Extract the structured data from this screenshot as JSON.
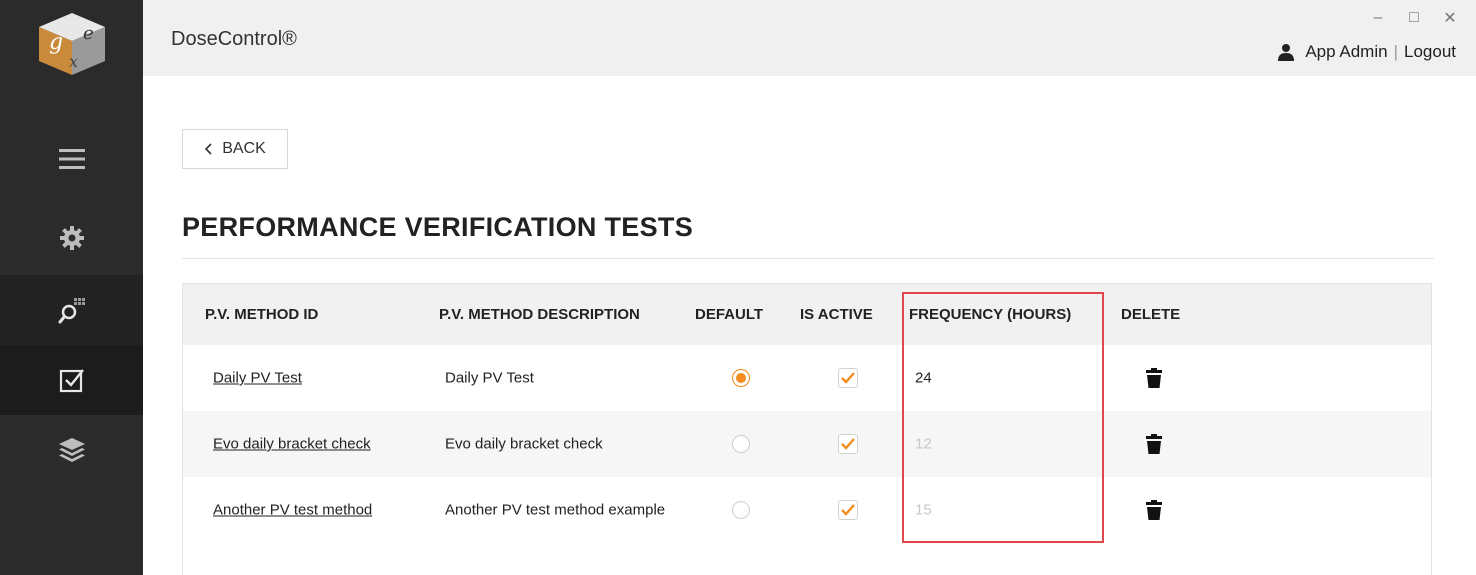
{
  "header": {
    "app_title": "DoseControl®",
    "user_name": "App Admin",
    "separator": "|",
    "logout_label": "Logout"
  },
  "sidebar": {
    "items": [
      {
        "icon": "hamburger-menu-icon"
      },
      {
        "icon": "gear-icon"
      },
      {
        "icon": "search-grid-icon"
      },
      {
        "icon": "checkbox-icon",
        "active": true
      },
      {
        "icon": "layers-icon"
      }
    ]
  },
  "back_label": "BACK",
  "page_title": "PERFORMANCE VERIFICATION TESTS",
  "table": {
    "headers": [
      "P.V. METHOD ID",
      "P.V. METHOD DESCRIPTION",
      "DEFAULT",
      "IS ACTIVE",
      "FREQUENCY (HOURS)",
      "DELETE"
    ],
    "rows": [
      {
        "id": "Daily PV Test",
        "description": "Daily PV Test",
        "default": true,
        "active": true,
        "frequency": "24"
      },
      {
        "id": "Evo daily bracket check",
        "description": "Evo daily bracket check",
        "default": false,
        "active": true,
        "frequency": "12"
      },
      {
        "id": "Another PV test method",
        "description": "Another PV test method example",
        "default": false,
        "active": true,
        "frequency": "15"
      }
    ]
  },
  "colors": {
    "accent": "#f28c1e",
    "sidebar": "#2b2b2b",
    "highlight": "#e0474c"
  }
}
